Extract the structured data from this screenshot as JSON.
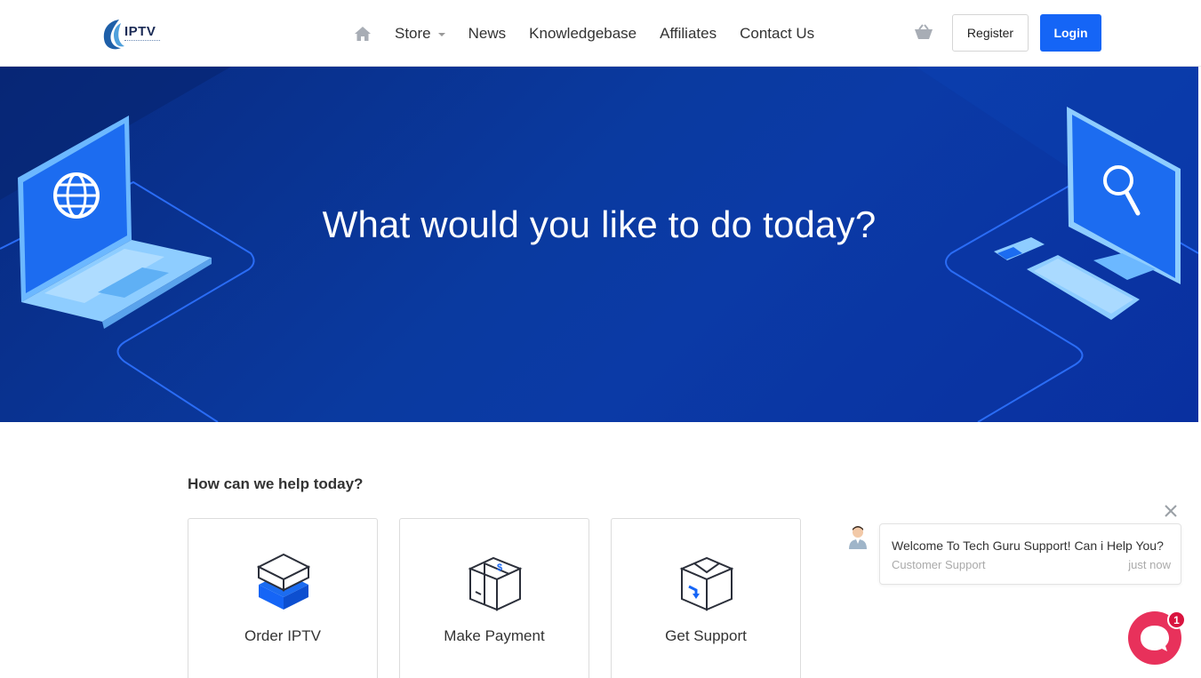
{
  "header": {
    "logo_text": "IPTV",
    "nav": {
      "store": "Store",
      "news": "News",
      "knowledgebase": "Knowledgebase",
      "affiliates": "Affiliates",
      "contact": "Contact Us"
    },
    "register_label": "Register",
    "login_label": "Login"
  },
  "hero": {
    "title": "What would you like to do today?"
  },
  "help": {
    "title": "How can we help today?",
    "cards": [
      {
        "label": "Order IPTV",
        "icon": "box-icon"
      },
      {
        "label": "Make Payment",
        "icon": "payment-box-icon"
      },
      {
        "label": "Get Support",
        "icon": "support-box-icon"
      }
    ]
  },
  "chat": {
    "message": "Welcome To Tech Guru Support! Can i Help You?",
    "sender": "Customer Support",
    "time": "just now",
    "badge_count": "1"
  },
  "colors": {
    "primary": "#1565f6",
    "hero_bg": "#0a3aa0",
    "chat_accent": "#e8315b"
  }
}
